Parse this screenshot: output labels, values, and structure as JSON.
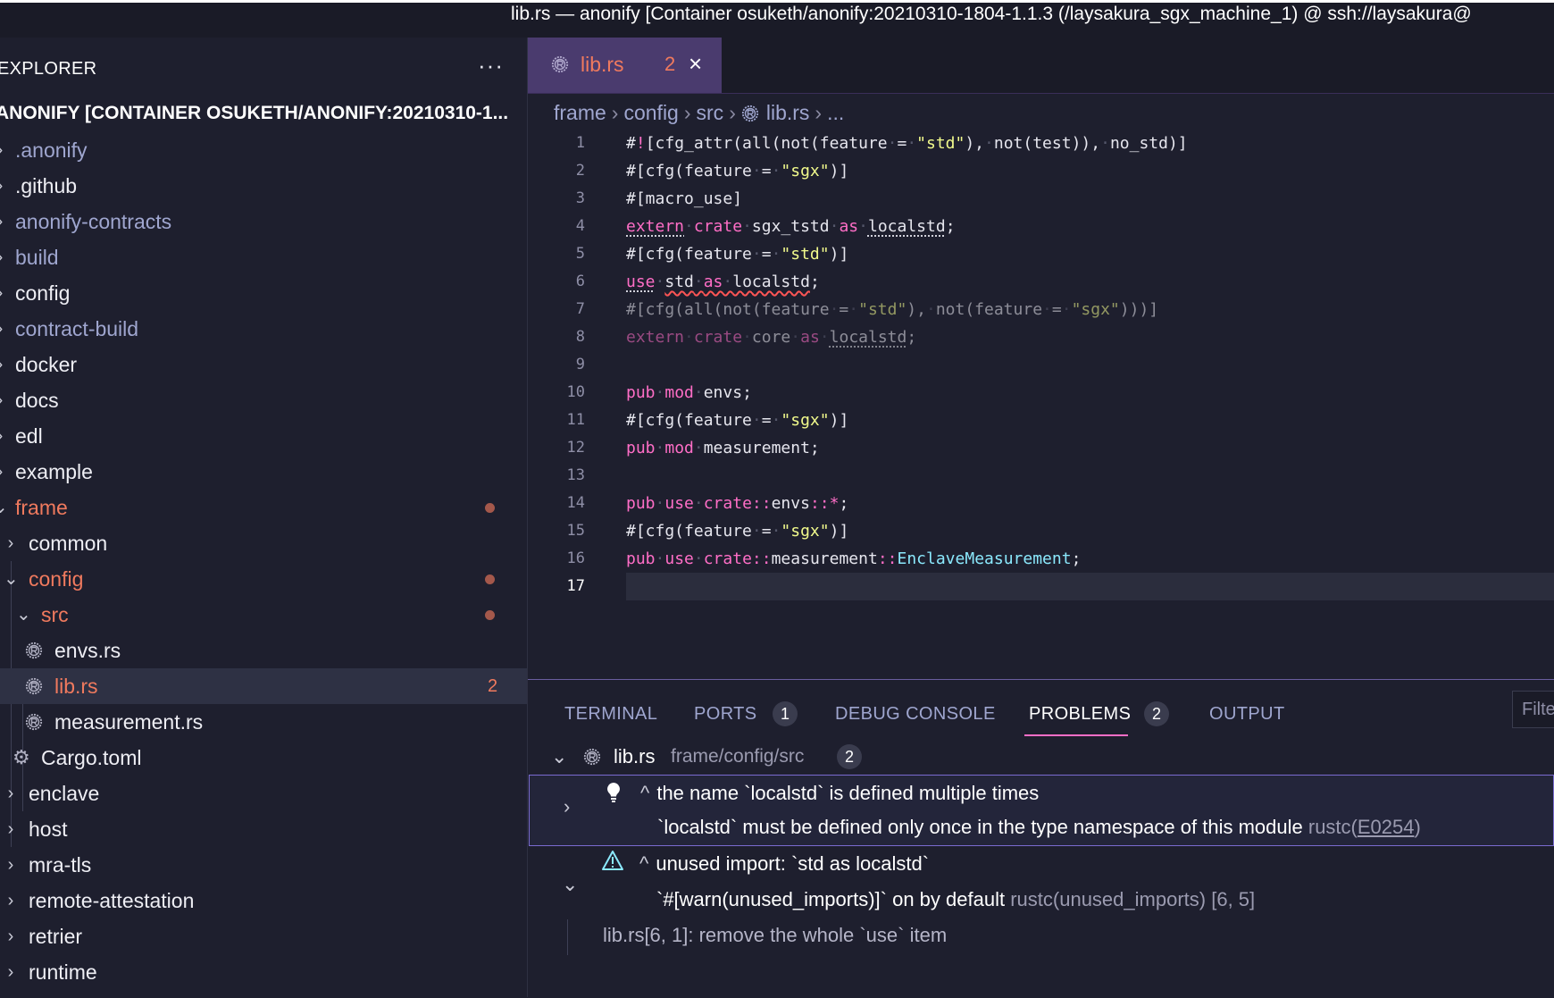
{
  "window": {
    "title": "lib.rs — anonify [Container osuketh/anonify:20210310-1804-1.1.3 (/laysakura_sgx_machine_1) @ ssh://laysakura@"
  },
  "explorer": {
    "label": "EXPLORER",
    "more": "···",
    "root": "ANONIFY [CONTAINER OSUKETH/ANONIFY:20210310-1...",
    "items": [
      {
        "label": ".anonify"
      },
      {
        "label": ".github"
      },
      {
        "label": "anonify-contracts"
      },
      {
        "label": "build"
      },
      {
        "label": "config"
      },
      {
        "label": "contract-build"
      },
      {
        "label": "docker"
      },
      {
        "label": "docs"
      },
      {
        "label": "edl"
      },
      {
        "label": "example"
      },
      {
        "label": "frame"
      },
      {
        "label": "common"
      },
      {
        "label": "config"
      },
      {
        "label": "src"
      },
      {
        "label": "envs.rs"
      },
      {
        "label": "lib.rs",
        "count": "2"
      },
      {
        "label": "measurement.rs"
      },
      {
        "label": "Cargo.toml"
      },
      {
        "label": "enclave"
      },
      {
        "label": "host"
      },
      {
        "label": "mra-tls"
      },
      {
        "label": "remote-attestation"
      },
      {
        "label": "retrier"
      },
      {
        "label": "runtime"
      }
    ]
  },
  "editor": {
    "tab": {
      "name": "lib.rs",
      "count": "2",
      "close": "×"
    },
    "breadcrumb": [
      "frame",
      "config",
      "src",
      "lib.rs",
      "..."
    ],
    "current_line": "17"
  },
  "panel": {
    "tabs": [
      {
        "label": "TERMINAL"
      },
      {
        "label": "PORTS",
        "badge": "1"
      },
      {
        "label": "DEBUG CONSOLE"
      },
      {
        "label": "PROBLEMS",
        "badge": "2"
      },
      {
        "label": "OUTPUT"
      }
    ],
    "filter_placeholder": "Filte",
    "file": {
      "name": "lib.rs",
      "path": "frame/config/src",
      "count": "2"
    },
    "problems": [
      {
        "message": "the name `localstd` is defined multiple times",
        "detail": "`localstd` must be defined only once in the type namespace of this module",
        "source": "rustc(",
        "code": "E0254",
        "source_end": ")"
      },
      {
        "message": "unused import: `std as localstd`",
        "detail": "`#[warn(unused_imports)]` on by default",
        "source": "rustc(unused_imports)",
        "position": "[6, 5]",
        "fix": "lib.rs[6, 1]: remove the whole `use` item"
      }
    ]
  }
}
